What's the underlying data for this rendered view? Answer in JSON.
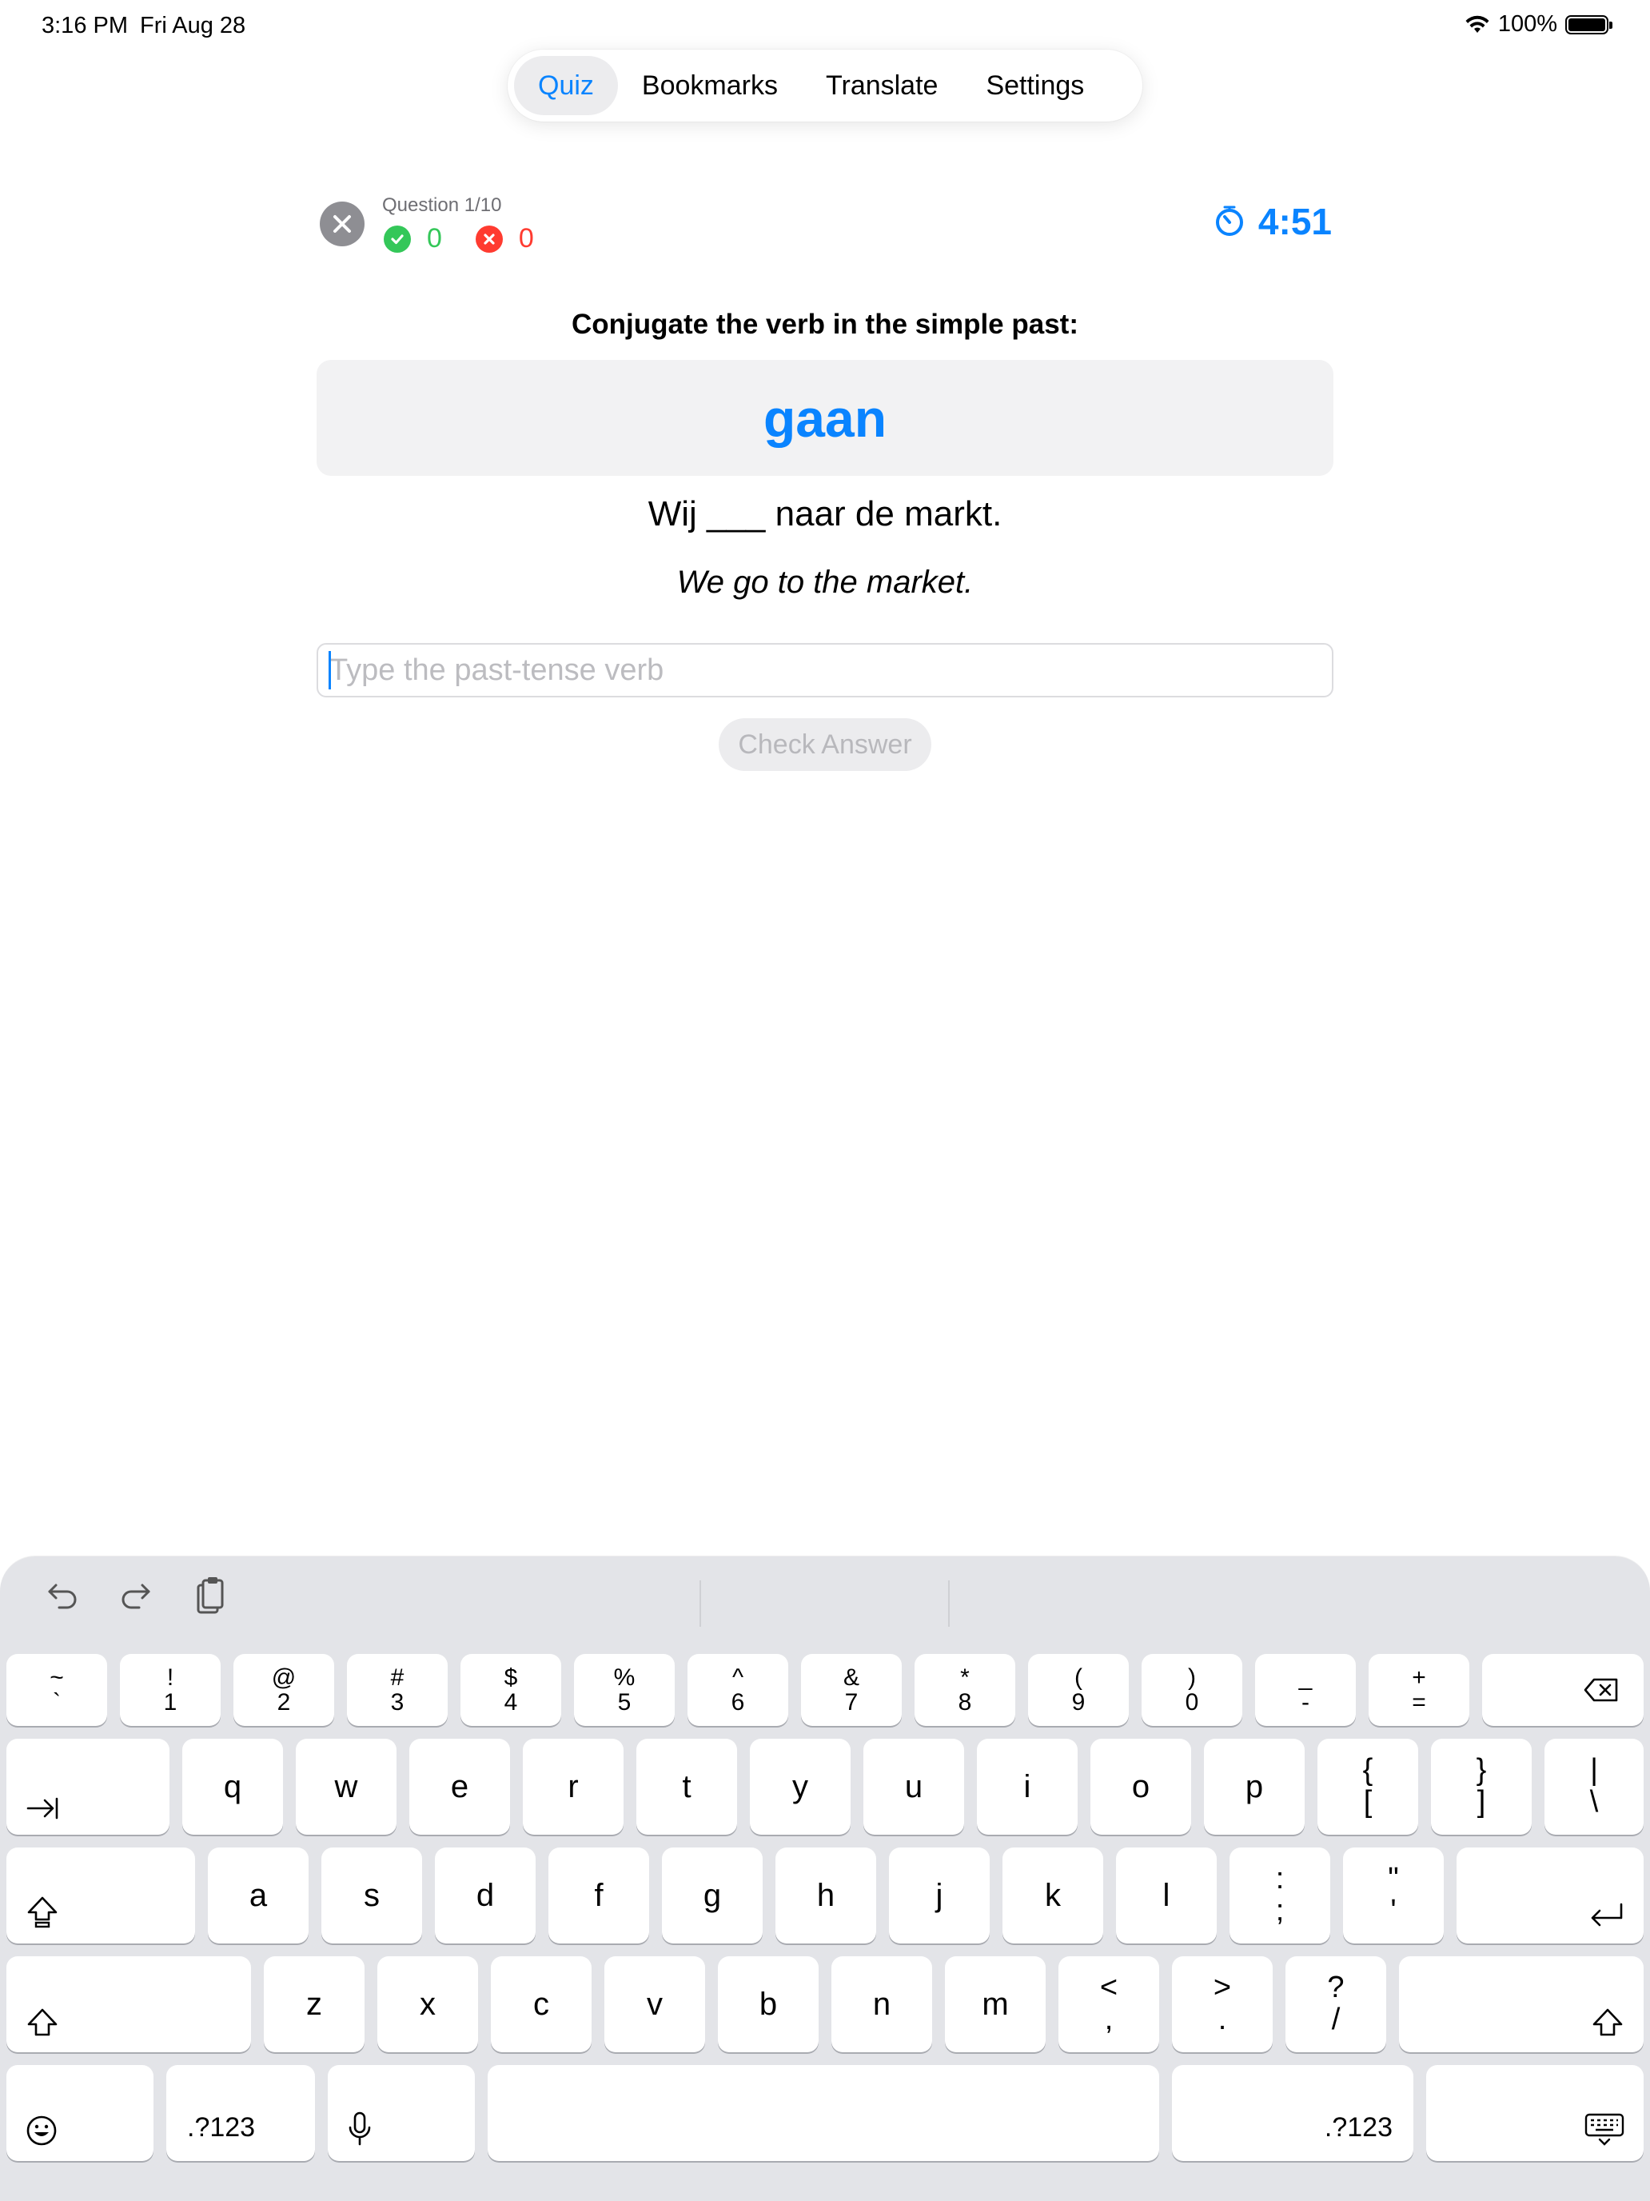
{
  "status_bar": {
    "time": "3:16 PM",
    "date": "Fri Aug 28",
    "battery": "100%"
  },
  "tabs": [
    {
      "label": "Quiz",
      "active": true
    },
    {
      "label": "Bookmarks",
      "active": false
    },
    {
      "label": "Translate",
      "active": false
    },
    {
      "label": "Settings",
      "active": false
    }
  ],
  "quiz": {
    "question_label": "Question 1/10",
    "correct_count": "0",
    "wrong_count": "0",
    "timer": "4:51",
    "prompt": "Conjugate the verb in the simple past:",
    "verb": "gaan",
    "sentence": "Wij ___ naar de markt.",
    "translation": "We go to the market.",
    "input_placeholder": "Type the past-tense verb",
    "input_value": "",
    "check_button": "Check Answer"
  },
  "colors": {
    "accent": "#0a84ff",
    "correct": "#34c759",
    "wrong": "#ff3b30"
  },
  "keyboard": {
    "toolbar_icons": [
      "undo-icon",
      "redo-icon",
      "clipboard-icon"
    ],
    "row_numbers": [
      {
        "top": "~",
        "bottom": "`"
      },
      {
        "top": "!",
        "bottom": "1"
      },
      {
        "top": "@",
        "bottom": "2"
      },
      {
        "top": "#",
        "bottom": "3"
      },
      {
        "top": "$",
        "bottom": "4"
      },
      {
        "top": "%",
        "bottom": "5"
      },
      {
        "top": "^",
        "bottom": "6"
      },
      {
        "top": "&",
        "bottom": "7"
      },
      {
        "top": "*",
        "bottom": "8"
      },
      {
        "top": "(",
        "bottom": "9"
      },
      {
        "top": ")",
        "bottom": "0"
      },
      {
        "top": "_",
        "bottom": "-"
      },
      {
        "top": "+",
        "bottom": "="
      }
    ],
    "row_q": [
      "q",
      "w",
      "e",
      "r",
      "t",
      "y",
      "u",
      "i",
      "o",
      "p"
    ],
    "row_q_symbols": [
      {
        "top": "{",
        "bottom": "["
      },
      {
        "top": "}",
        "bottom": "]"
      },
      {
        "top": "|",
        "bottom": "\\"
      }
    ],
    "row_a": [
      "a",
      "s",
      "d",
      "f",
      "g",
      "h",
      "j",
      "k",
      "l"
    ],
    "row_a_symbols": [
      {
        "top": ":",
        "bottom": ";"
      },
      {
        "top": "\"",
        "bottom": "'"
      }
    ],
    "row_z": [
      "z",
      "x",
      "c",
      "v",
      "b",
      "n",
      "m"
    ],
    "row_z_symbols": [
      {
        "top": "<",
        "bottom": ","
      },
      {
        "top": ">",
        "bottom": "."
      },
      {
        "top": "?",
        "bottom": "/"
      }
    ],
    "numbers_key": ".?123"
  }
}
